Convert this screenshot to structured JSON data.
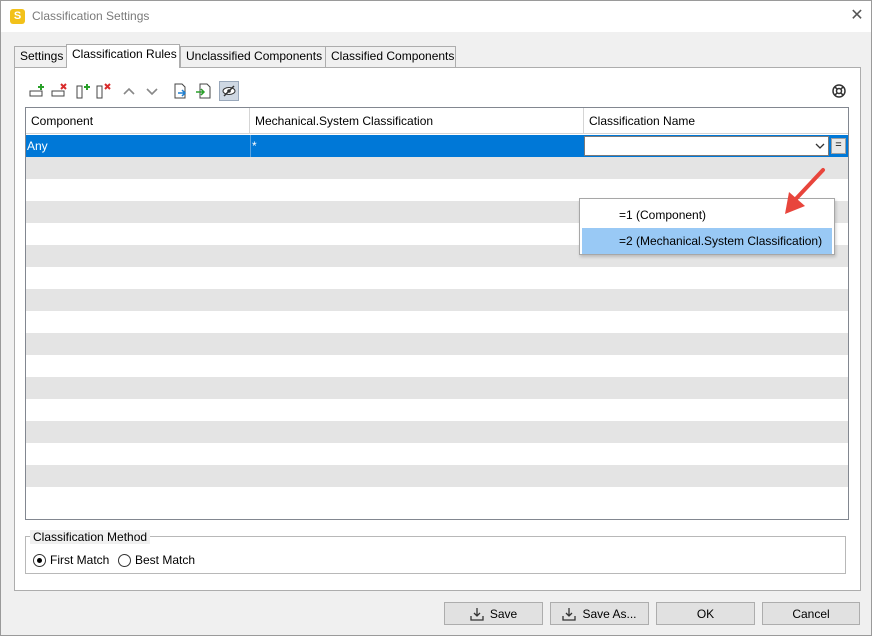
{
  "window": {
    "title": "Classification Settings",
    "app_icon_letter": "S",
    "close_glyph": "✕"
  },
  "tabs": [
    {
      "label": "Settings",
      "active": false
    },
    {
      "label": "Classification Rules",
      "active": true
    },
    {
      "label": "Unclassified Components",
      "active": false
    },
    {
      "label": "Classified Components",
      "active": false
    }
  ],
  "toolbar": {
    "icons": [
      "add-row-icon",
      "delete-row-icon",
      "add-column-icon",
      "delete-column-icon",
      "move-up-icon",
      "move-down-icon",
      "export-icon",
      "import-icon",
      "hide-toggle-icon",
      "help-lifebuoy-icon"
    ]
  },
  "grid": {
    "columns": [
      "Component",
      "Mechanical.System Classification",
      "Classification Name"
    ],
    "selected_row": {
      "component": "Any",
      "classification": "*",
      "name": ""
    },
    "equals_button": "="
  },
  "dropdown": {
    "items": [
      {
        "label": "=1 (Component)",
        "highlighted": false
      },
      {
        "label": "=2 (Mechanical.System Classification)",
        "highlighted": true
      }
    ]
  },
  "method": {
    "legend": "Classification Method",
    "options": [
      {
        "label": "First Match",
        "checked": true
      },
      {
        "label": "Best Match",
        "checked": false
      }
    ]
  },
  "buttons": {
    "save": "Save",
    "save_as": "Save As...",
    "ok": "OK",
    "cancel": "Cancel"
  },
  "colors": {
    "selection": "#0078d7",
    "dropdown_highlight": "#99c9f5",
    "annotation_arrow": "#e8453c",
    "app_icon": "#f2c11a"
  }
}
